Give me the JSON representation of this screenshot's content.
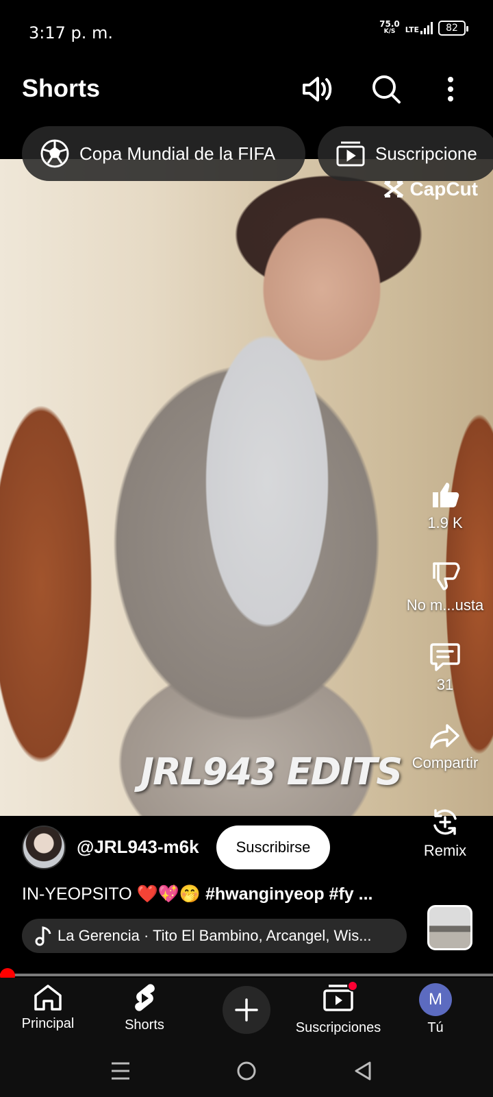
{
  "status_bar": {
    "time": "3:17 p. m.",
    "net_speed_value": "75.0",
    "net_speed_unit": "K/S",
    "network": "LTE",
    "battery": "82"
  },
  "header": {
    "title": "Shorts",
    "icons": [
      "cast-audio-icon",
      "search-icon",
      "more-vert-icon"
    ]
  },
  "chips": [
    {
      "label": "Copa Mundial de la FIFA",
      "icon": "soccer-ball-icon"
    },
    {
      "label": "Suscripcione",
      "icon": "subscriptions-icon"
    }
  ],
  "video": {
    "capcut_label": "CapCut",
    "watermark": "JRL943 EDITS"
  },
  "actions": {
    "like_count": "1.9 K",
    "dislike_label": "No m...usta",
    "comments_count": "31",
    "share_label": "Compartir",
    "remix_label": "Remix"
  },
  "channel": {
    "handle": "@JRL943-m6k",
    "subscribe_label": "Suscribirse"
  },
  "caption": {
    "text": "IN-YEOPSITO ❤️💖🤭",
    "hashtags": "#hwanginyeop #fy ..."
  },
  "music": {
    "label": "La Gerencia · Tito El Bambino, Arcangel, Wis..."
  },
  "playback": {
    "progress_fraction": 0.0
  },
  "bottom_nav": {
    "home": "Principal",
    "shorts": "Shorts",
    "subscriptions": "Suscripciones",
    "you": "Tú",
    "you_avatar_letter": "M"
  },
  "colors": {
    "accent": "#ff0000",
    "avatar_bg": "#5c6bc0"
  }
}
